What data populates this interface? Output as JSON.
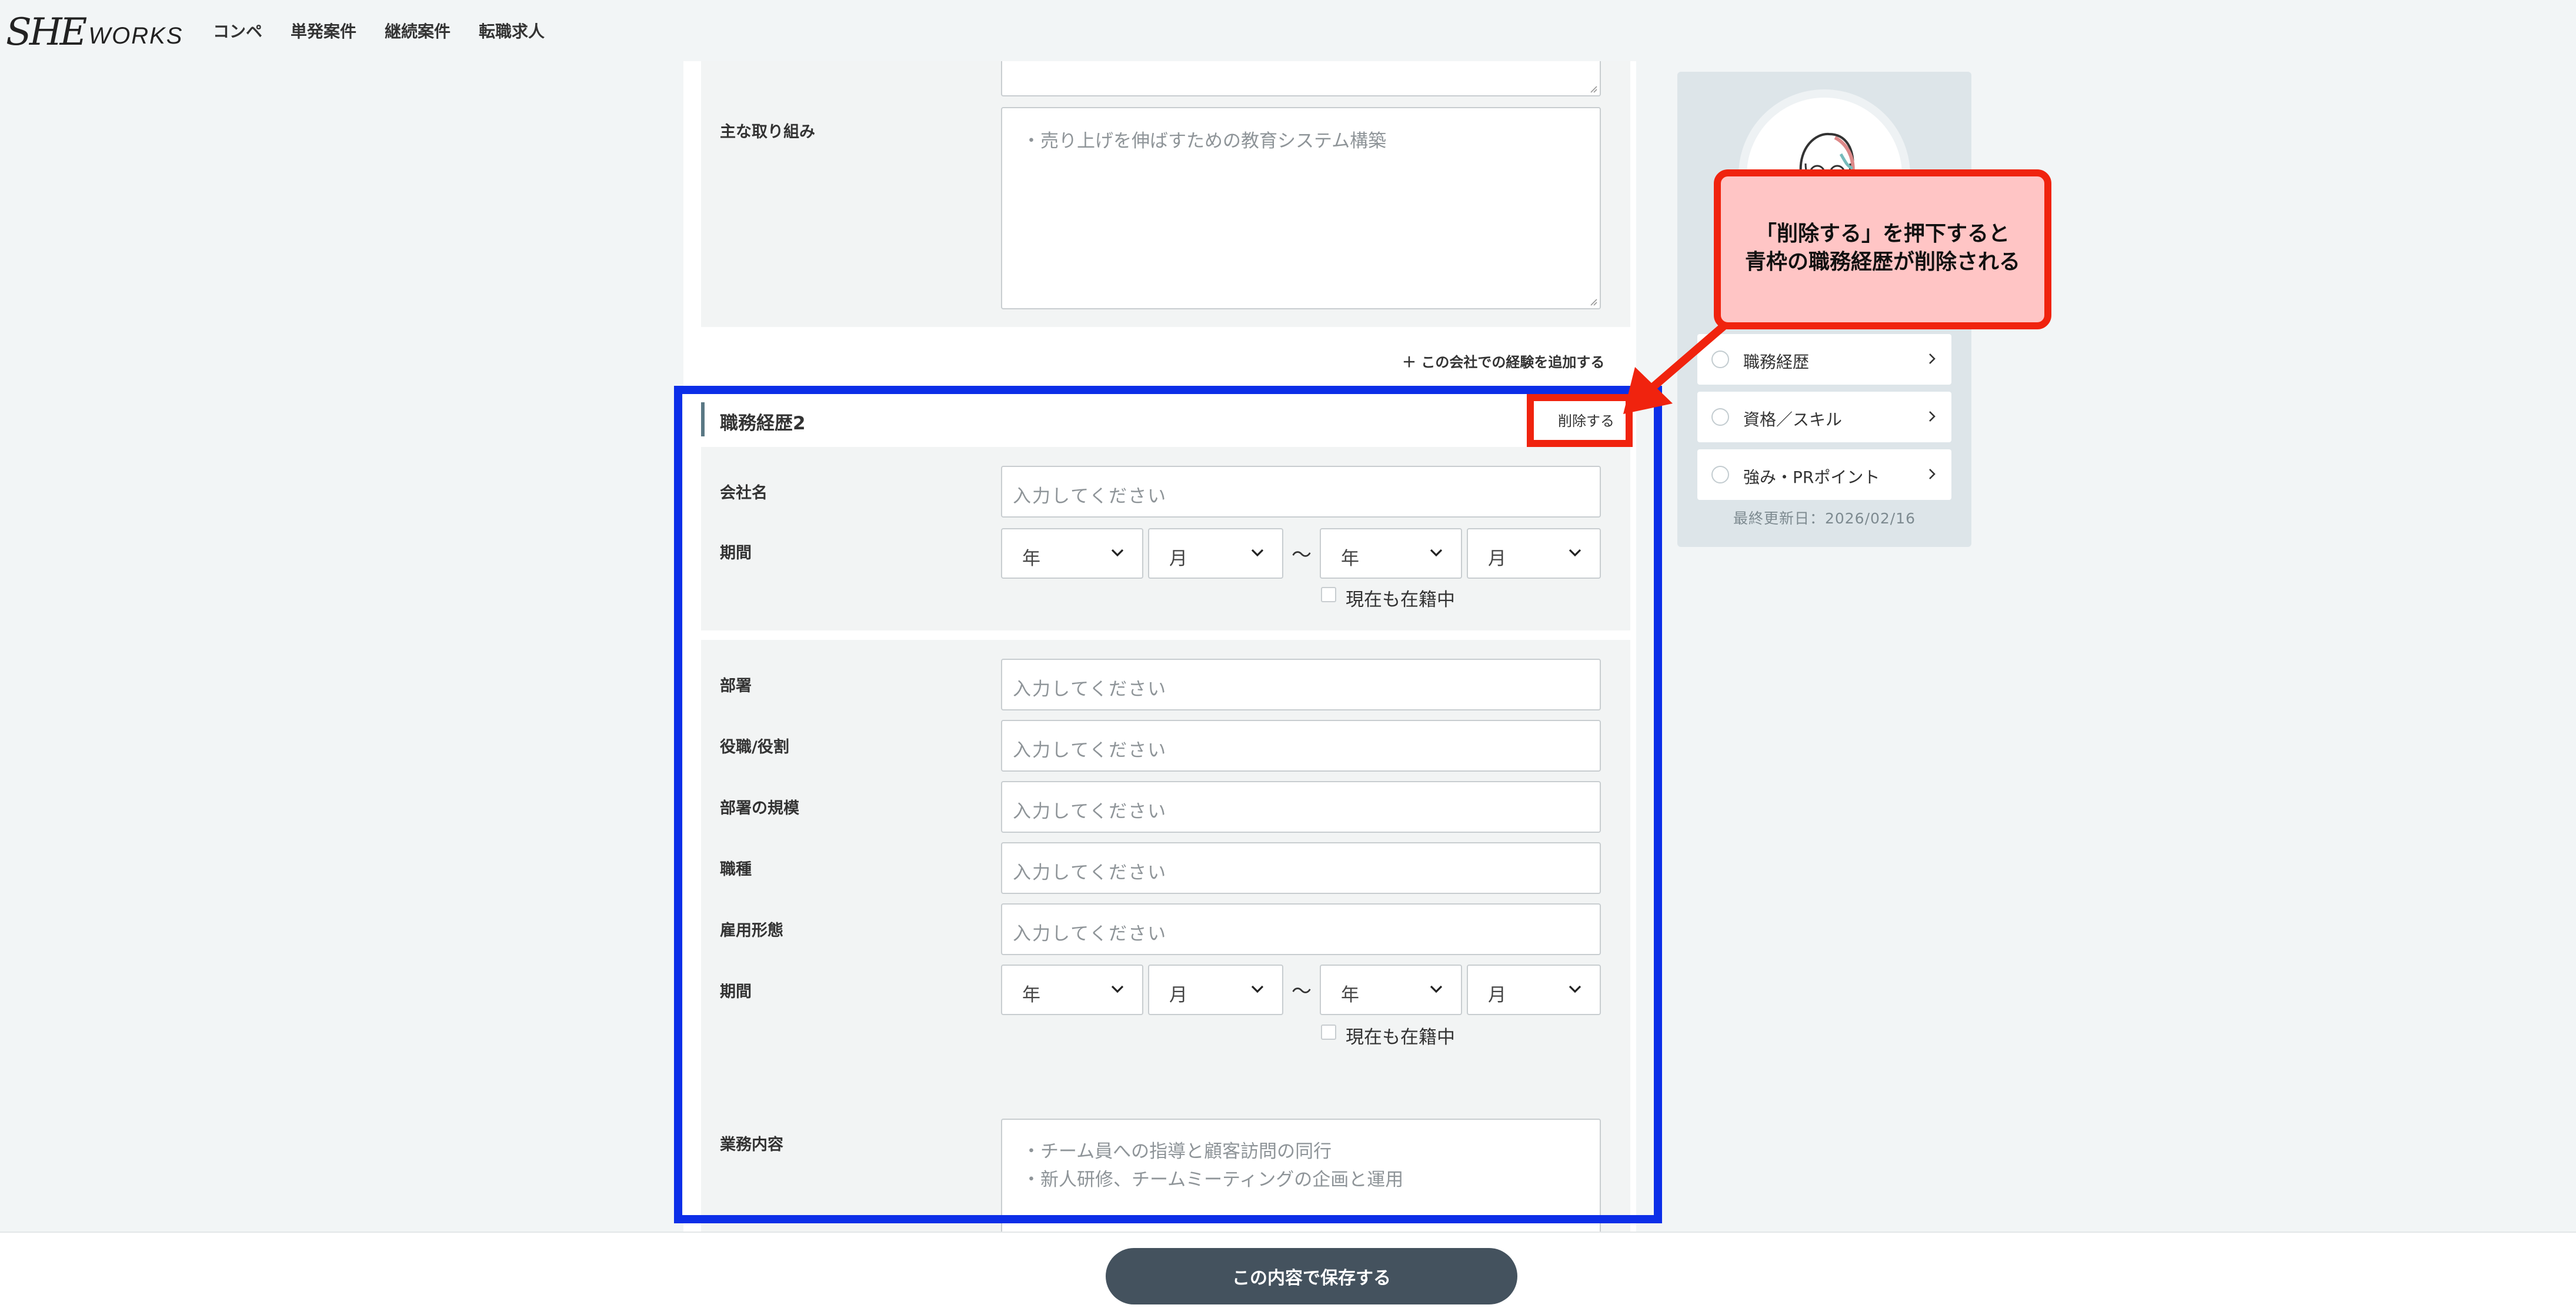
{
  "header": {
    "logo_she": "SHE",
    "logo_works": "WORKS",
    "nav": [
      "コンペ",
      "単発案件",
      "継続案件",
      "転職求人"
    ]
  },
  "career1": {
    "main_efforts_label": "主な取り組み",
    "main_efforts_placeholder": "・売り上げを伸ばすための教育システム構築"
  },
  "add_experience_link": "＋ この会社での経験を追加する",
  "career2": {
    "title": "職務経歴2",
    "delete_label": "削除する",
    "company_label": "会社名",
    "period_label": "期間",
    "placeholder": "入力してください",
    "year": "年",
    "month": "月",
    "tilde": "〜",
    "currently_employed": "現在も在籍中",
    "department_label": "部署",
    "role_label": "役職/役割",
    "dept_scale_label": "部署の規模",
    "job_type_label": "職種",
    "employment_type_label": "雇用形態",
    "duties_label": "業務内容",
    "duties_placeholder_1": "・チーム員への指導と顧客訪問の同行",
    "duties_placeholder_2": "・新人研修、チームミーティングの企画と運用"
  },
  "sidebar": {
    "items": [
      {
        "label": "職務経歴"
      },
      {
        "label": "資格／スキル"
      },
      {
        "label": "強み・PRポイント"
      }
    ],
    "last_updated": "最終更新日：2026/02/16"
  },
  "annotation": {
    "line1": "「削除する」を押下すると",
    "line2": "青枠の職務経歴が削除される",
    "colors": {
      "blue_frame": "#0c2ee8",
      "red": "#f0230e",
      "callout_bg": "#ffc5c5"
    }
  },
  "save_button": "この内容で保存する"
}
